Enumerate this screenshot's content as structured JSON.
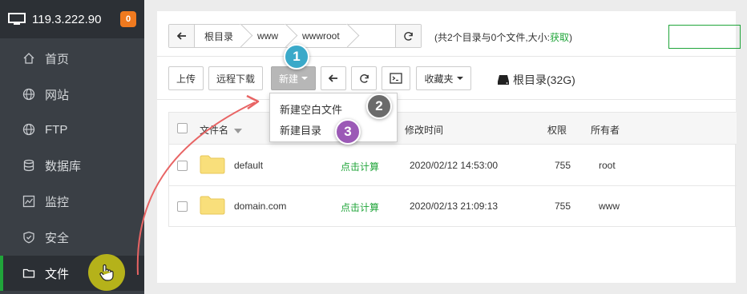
{
  "sidebar": {
    "server_ip": "119.3.222.90",
    "badge_count": "0",
    "items": [
      {
        "label": "首页",
        "icon": "home-icon"
      },
      {
        "label": "网站",
        "icon": "globe-icon"
      },
      {
        "label": "FTP",
        "icon": "globe-icon"
      },
      {
        "label": "数据库",
        "icon": "database-icon"
      },
      {
        "label": "监控",
        "icon": "monitor-chart-icon"
      },
      {
        "label": "安全",
        "icon": "shield-icon"
      },
      {
        "label": "文件",
        "icon": "folder-icon",
        "active": true
      }
    ]
  },
  "path": {
    "crumbs": [
      "根目录",
      "www",
      "wwwroot"
    ],
    "info_prefix": "(共2个目录与0个文件,大小:",
    "info_link": "获取",
    "info_suffix": ")"
  },
  "toolbar": {
    "upload": "上传",
    "remote_download": "远程下载",
    "new": "新建",
    "favorites": "收藏夹",
    "disk": "根目录(32G)"
  },
  "new_menu": {
    "items": [
      "新建空白文件",
      "新建目录"
    ]
  },
  "table": {
    "headers": {
      "name": "文件名",
      "modified": "修改时间",
      "permission": "权限",
      "owner": "所有者"
    },
    "rows": [
      {
        "name": "default",
        "size": "点击计算",
        "modified": "2020/02/12 14:53:00",
        "permission": "755",
        "owner": "root"
      },
      {
        "name": "domain.com",
        "size": "点击计算",
        "modified": "2020/02/13 21:09:13",
        "permission": "755",
        "owner": "www"
      }
    ]
  },
  "steps": [
    "1",
    "2",
    "3"
  ],
  "colors": {
    "accent_green": "#20a53a",
    "badge_orange": "#f07a1f",
    "sidebar_bg": "#3a3f45",
    "step1": "#3aa9c9",
    "step2": "#6b6b6b",
    "step3": "#9b59b6",
    "arrow": "#e86464"
  }
}
